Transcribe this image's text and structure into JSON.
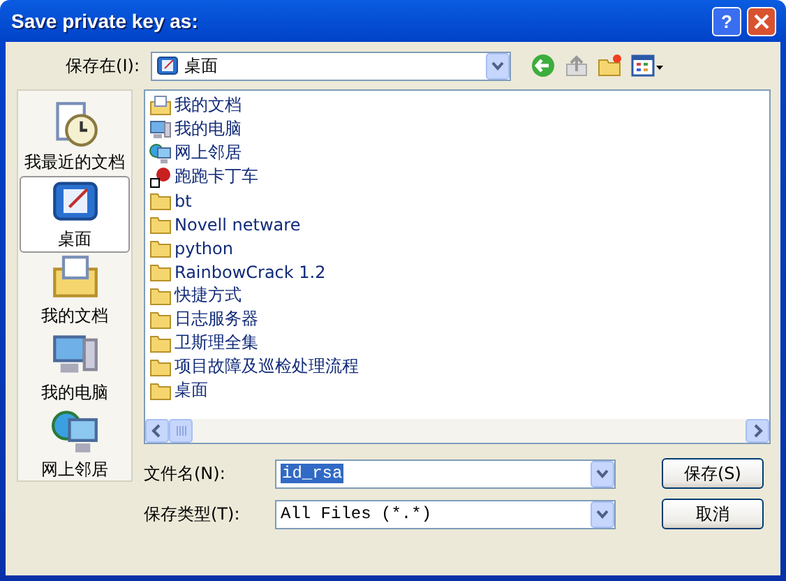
{
  "window": {
    "title": "Save private key as:",
    "help_label": "?"
  },
  "save_in": {
    "label": "保存在(I):",
    "value": "桌面"
  },
  "toolbar": [
    {
      "kind": "back",
      "disabled": false
    },
    {
      "kind": "up",
      "disabled": true
    },
    {
      "kind": "new_folder",
      "disabled": false
    },
    {
      "kind": "views",
      "disabled": false
    }
  ],
  "places": [
    {
      "label": "我最近的文档",
      "kind": "recent",
      "selected": false
    },
    {
      "label": "桌面",
      "kind": "desktop",
      "selected": true
    },
    {
      "label": "我的文档",
      "kind": "documents",
      "selected": false
    },
    {
      "label": "我的电脑",
      "kind": "computer",
      "selected": false
    },
    {
      "label": "网上邻居",
      "kind": "network",
      "selected": false
    }
  ],
  "files": [
    {
      "name": "我的文档",
      "kind": "documents"
    },
    {
      "name": "我的电脑",
      "kind": "computer"
    },
    {
      "name": "网上邻居",
      "kind": "network"
    },
    {
      "name": "跑跑卡丁车",
      "kind": "shortcut"
    },
    {
      "name": "bt",
      "kind": "folder"
    },
    {
      "name": "Novell netware",
      "kind": "folder"
    },
    {
      "name": "python",
      "kind": "folder"
    },
    {
      "name": "RainbowCrack 1.2",
      "kind": "folder"
    },
    {
      "name": "快捷方式",
      "kind": "folder"
    },
    {
      "name": "日志服务器",
      "kind": "folder"
    },
    {
      "name": "卫斯理全集",
      "kind": "folder"
    },
    {
      "name": "项目故障及巡检处理流程",
      "kind": "folder"
    },
    {
      "name": "桌面",
      "kind": "folder"
    }
  ],
  "file_name": {
    "label": "文件名(N):",
    "value": "id_rsa",
    "text_selected": true
  },
  "file_type": {
    "label": "保存类型(T):",
    "value": "All Files (*.*)"
  },
  "buttons": [
    {
      "label": "保存(S)"
    },
    {
      "label": "取消"
    }
  ]
}
